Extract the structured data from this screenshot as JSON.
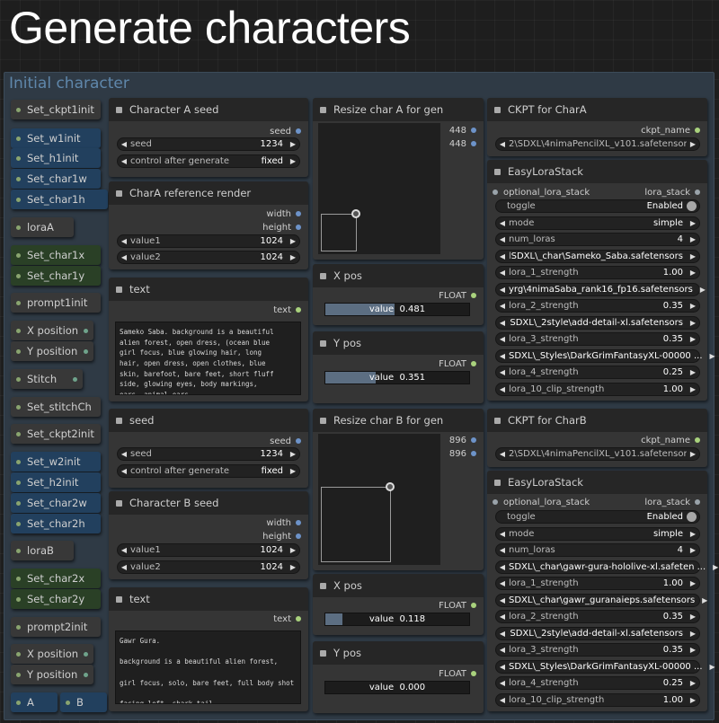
{
  "page_title": "Generate characters",
  "group_title": "Initial character",
  "pills": [
    {
      "label": "Set_ckpt1init",
      "style": "gray"
    },
    {
      "label": "Set_w1init",
      "style": "blue"
    },
    {
      "label": "Set_h1init",
      "style": "blue"
    },
    {
      "label": "Set_char1w",
      "style": "blue"
    },
    {
      "label": "Set_char1h",
      "style": "blue"
    },
    {
      "label": "loraA",
      "style": "gray"
    },
    {
      "label": "Set_char1x",
      "style": "green"
    },
    {
      "label": "Set_char1y",
      "style": "green"
    },
    {
      "label": "prompt1init",
      "style": "gray"
    },
    {
      "label": "X position",
      "style": "gray"
    },
    {
      "label": "Y position",
      "style": "gray"
    },
    {
      "label": "Stitch",
      "style": "gray"
    },
    {
      "label": "Set_stitchCh",
      "style": "gray"
    },
    {
      "label": "Set_ckpt2init",
      "style": "gray"
    },
    {
      "label": "Set_w2init",
      "style": "blue"
    },
    {
      "label": "Set_h2init",
      "style": "blue"
    },
    {
      "label": "Set_char2w",
      "style": "blue"
    },
    {
      "label": "Set_char2h",
      "style": "blue"
    },
    {
      "label": "loraB",
      "style": "gray"
    },
    {
      "label": "Set_char2x",
      "style": "green"
    },
    {
      "label": "Set_char2y",
      "style": "green"
    },
    {
      "label": "prompt2init",
      "style": "gray"
    },
    {
      "label": "X position",
      "style": "gray"
    },
    {
      "label": "Y position",
      "style": "gray"
    },
    {
      "label": "A",
      "style": "blue"
    },
    {
      "label": "B",
      "style": "blue"
    }
  ],
  "seed_a": {
    "title": "Character A seed",
    "output": "seed",
    "seed_label": "seed",
    "seed_value": "1234",
    "control_label": "control after generate",
    "control_value": "fixed"
  },
  "ref_render": {
    "title": "CharA reference render",
    "out_width": "width",
    "out_height": "height",
    "value1_label": "value1",
    "value1": "1024",
    "value2_label": "value2",
    "value2": "1024"
  },
  "text_a": {
    "title": "text",
    "output": "text",
    "content": "Sameko Saba. background is a beautiful\nalien forest, open dress, (ocean blue\ngirl focus, blue glowing hair, long\nhair, open dress, open clothes, blue\nskin, barefoot, bare feet, short fluff\nside, glowing eyes, body markings,\nears, animal ears"
  },
  "resize_a": {
    "title": "Resize char A for gen",
    "out1": "448",
    "out2": "448"
  },
  "xpos_a": {
    "title": "X pos",
    "output": "FLOAT",
    "label": "value",
    "value": "0.481",
    "fill": 0.481
  },
  "ypos_a": {
    "title": "Y pos",
    "output": "FLOAT",
    "label": "value",
    "value": "0.351",
    "fill": 0.351
  },
  "ckpt_a": {
    "title": "CKPT for CharA",
    "output": "ckpt_name",
    "value": "2\\SDXL\\4nimaPencilXL_v101.safetensors"
  },
  "lora_a": {
    "title": "EasyLoraStack",
    "input": "optional_lora_stack",
    "output": "lora_stack",
    "rows": [
      {
        "label": "toggle",
        "value": "Enabled",
        "kind": "toggle"
      },
      {
        "label": "mode",
        "value": "simple",
        "kind": "select"
      },
      {
        "label": "num_loras",
        "value": "4",
        "kind": "select"
      },
      {
        "label": "l...",
        "value": "SDXL\\_char\\Sameko_Saba.safetensors",
        "kind": "select"
      },
      {
        "label": "lora_1_strength",
        "value": "1.00",
        "kind": "select"
      },
      {
        "label": "",
        "value": "yrg\\4nimaSaba_rank16_fp16.safetensors",
        "kind": "select"
      },
      {
        "label": "lora_2_strength",
        "value": "0.35",
        "kind": "select"
      },
      {
        "label": "lor...",
        "value": "SDXL\\_2style\\add-detail-xl.safetensors",
        "kind": "select"
      },
      {
        "label": "lora_3_strength",
        "value": "0.35",
        "kind": "select"
      },
      {
        "label": "",
        "value": "SDXL\\_Styles\\DarkGrimFantasyXL-00000 ...",
        "kind": "select"
      },
      {
        "label": "lora_4_strength",
        "value": "0.25",
        "kind": "select"
      },
      {
        "label": "lora_10_clip_strength",
        "value": "1.00",
        "kind": "select"
      }
    ]
  },
  "seed_b": {
    "title": "seed",
    "output": "seed",
    "seed_label": "seed",
    "seed_value": "1234",
    "control_label": "control after generate",
    "control_value": "fixed"
  },
  "seed_b2": {
    "title": "Character B seed",
    "out_width": "width",
    "out_height": "height",
    "value1_label": "value1",
    "value1": "1024",
    "value2_label": "value2",
    "value2": "1024"
  },
  "text_b": {
    "title": "text",
    "output": "text",
    "content": "Gawr Gura.\n\nbackground is a beautiful alien forest,\n\ngirl focus, solo, bare feet, full body shot\n\nfacing left, shark tail"
  },
  "resize_b": {
    "title": "Resize char B for gen",
    "out1": "896",
    "out2": "896"
  },
  "xpos_b": {
    "title": "X pos",
    "output": "FLOAT",
    "label": "value",
    "value": "0.118",
    "fill": 0.118
  },
  "ypos_b": {
    "title": "Y pos",
    "output": "FLOAT",
    "label": "value",
    "value": "0.000",
    "fill": 0.0
  },
  "ckpt_b": {
    "title": "CKPT for CharB",
    "output": "ckpt_name",
    "value": "2\\SDXL\\4nimaPencilXL_v101.safetensors"
  },
  "lora_b": {
    "title": "EasyLoraStack",
    "input": "optional_lora_stack",
    "output": "lora_stack",
    "rows": [
      {
        "label": "toggle",
        "value": "Enabled",
        "kind": "toggle"
      },
      {
        "label": "mode",
        "value": "simple",
        "kind": "select"
      },
      {
        "label": "num_loras",
        "value": "4",
        "kind": "select"
      },
      {
        "label": "",
        "value": "SDXL\\_char\\gawr-gura-hololive-xl.safeten ...",
        "kind": "select"
      },
      {
        "label": "lora_1_strength",
        "value": "1.00",
        "kind": "select"
      },
      {
        "label": "",
        "value": "SDXL\\_char\\gawr_guranaieps.safetensors",
        "kind": "select"
      },
      {
        "label": "lora_2_strength",
        "value": "0.35",
        "kind": "select"
      },
      {
        "label": "lor...",
        "value": "SDXL\\_2style\\add-detail-xl.safetensors",
        "kind": "select"
      },
      {
        "label": "lora_3_strength",
        "value": "0.35",
        "kind": "select"
      },
      {
        "label": "",
        "value": "SDXL\\_Styles\\DarkGrimFantasyXL-00000 ...",
        "kind": "select"
      },
      {
        "label": "lora_4_strength",
        "value": "0.25",
        "kind": "select"
      },
      {
        "label": "lora_10_clip_strength",
        "value": "1.00",
        "kind": "select"
      }
    ]
  }
}
